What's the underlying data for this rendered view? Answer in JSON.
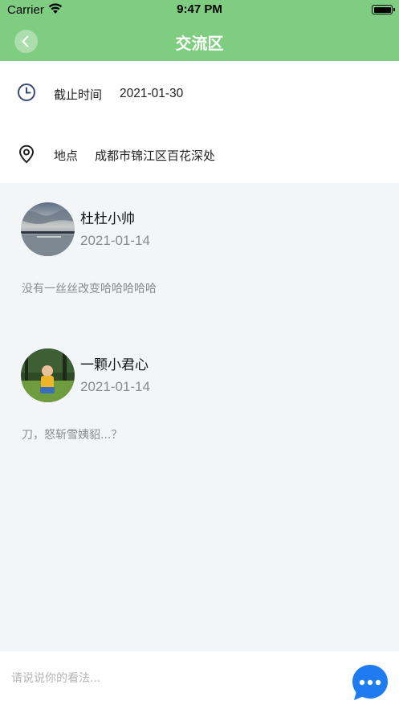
{
  "status_bar": {
    "carrier": "Carrier",
    "time": "9:47 PM"
  },
  "nav": {
    "title": "交流区",
    "back_icon": "chevron-left-icon"
  },
  "info": {
    "deadline_label": "截止时间",
    "deadline_value": "2021-01-30",
    "location_label": "地点",
    "location_value": "成都市锦江区百花深处"
  },
  "comments": [
    {
      "name": "杜杜小帅",
      "date": "2021-01-14",
      "text": "没有一丝丝改变哈哈哈哈哈"
    },
    {
      "name": "一颗小君心",
      "date": "2021-01-14",
      "text": "刀，怒斩雪姨貂...？"
    }
  ],
  "input": {
    "placeholder": "请说说你的看法...",
    "value": ""
  },
  "colors": {
    "theme_green": "#7fcd80",
    "chat_button_blue": "#1e7cf0",
    "icon_navy": "#3a4a75"
  }
}
